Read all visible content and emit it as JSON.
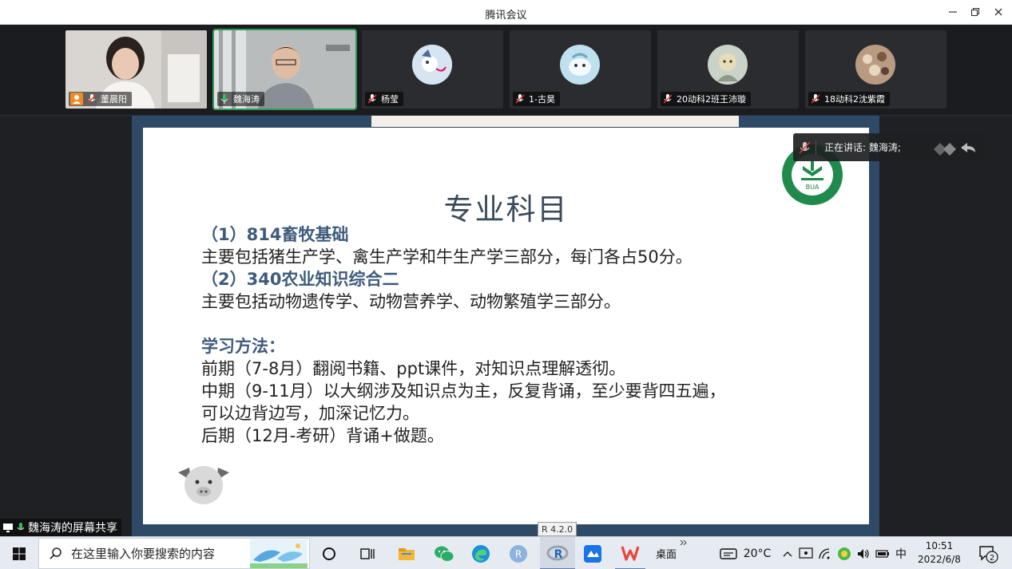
{
  "window": {
    "title": "腾讯会议"
  },
  "participants": [
    {
      "name": "董晨阳",
      "has_video": true,
      "active": false
    },
    {
      "name": "魏海涛",
      "has_video": true,
      "active": true
    },
    {
      "name": "杨莹",
      "has_video": false,
      "active": false,
      "avatar_color": "#d7e4f2"
    },
    {
      "name": "1-古昊",
      "has_video": false,
      "active": false,
      "avatar_color": "#bfe0ee"
    },
    {
      "name": "20动科2班王沛璇",
      "has_video": false,
      "active": false,
      "avatar_color": "#c9d3c7"
    },
    {
      "name": "18动科2沈紫霞",
      "has_video": false,
      "active": false,
      "avatar_color": "#b99b82"
    }
  ],
  "slide": {
    "title": "专业科目",
    "lines": [
      {
        "text": "（1）814畜牧基础",
        "type": "head"
      },
      {
        "text": "主要包括猪生产学、禽生产学和牛生产学三部分，每门各占50分。",
        "type": "body"
      },
      {
        "text": "（2）340农业知识综合二",
        "type": "head"
      },
      {
        "text": "主要包括动物遗传学、动物营养学、动物繁殖学三部分。",
        "type": "body"
      },
      {
        "text": "",
        "type": "blank"
      },
      {
        "text": "学习方法：",
        "type": "head"
      },
      {
        "text": "前期（7-8月）翻阅书籍、ppt课件，对知识点理解透彻。",
        "type": "body"
      },
      {
        "text": "中期（9-11月）以大纲涉及知识点为主，反复背诵，至少要背四五遍，",
        "type": "body"
      },
      {
        "text": "可以边背边写，加深记忆力。",
        "type": "body"
      },
      {
        "text": "后期（12月-考研）背诵+做题。",
        "type": "body"
      }
    ],
    "logo_text": "BUA"
  },
  "speaking_indicator": {
    "label": "正在讲话: 魏海涛;"
  },
  "share_label": "魏海涛的屏幕共享",
  "tooltip": "R 4.2.0",
  "taskbar": {
    "search_placeholder": "在这里输入你要搜索的内容",
    "desktop_label": "桌面",
    "weather": "20°C",
    "ime": "中",
    "time": "10:51",
    "date": "2022/6/8",
    "notification_count": "2"
  },
  "colors": {
    "active_border": "#2e9d57",
    "slide_heading": "#3e5b7c",
    "slide_frame": "#2e4a66",
    "logo_green": "#1f8a4c"
  }
}
